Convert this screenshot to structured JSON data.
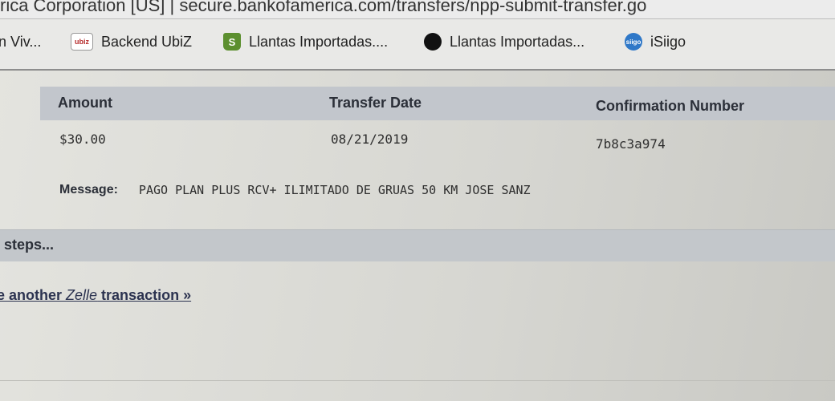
{
  "address_bar": {
    "text": "rica Corporation [US] | secure.bankofamerica.com/transfers/npp-submit-transfer.go"
  },
  "bookmarks": [
    {
      "label": "n Viv...",
      "icon": "none"
    },
    {
      "label": "Backend UbiZ",
      "icon": "ubiz-icon",
      "icon_text": "ubiz"
    },
    {
      "label": "Llantas Importadas....",
      "icon": "shopify-bag-icon"
    },
    {
      "label": "Llantas Importadas...",
      "icon": "dark-circle-icon"
    },
    {
      "label": "iSiigo",
      "icon": "siigo-icon",
      "icon_text": "siigo"
    }
  ],
  "transfer": {
    "headers": {
      "amount": "Amount",
      "date": "Transfer Date",
      "confirmation": "Confirmation Number"
    },
    "values": {
      "amount": "$30.00",
      "date": "08/21/2019",
      "confirmation": "7b8c3a974"
    },
    "message_label": "Message:",
    "message_text": "PAGO PLAN PLUS RCV+ ILIMITADO DE GRUAS 50 KM JOSE SANZ"
  },
  "next_steps": {
    "title": "xt steps...",
    "link_prefix": "ke another ",
    "link_brand": "Zelle",
    "link_suffix": " transaction »"
  },
  "colors": {
    "header_bar": "#c2c6cc",
    "link": "#2c3350"
  }
}
